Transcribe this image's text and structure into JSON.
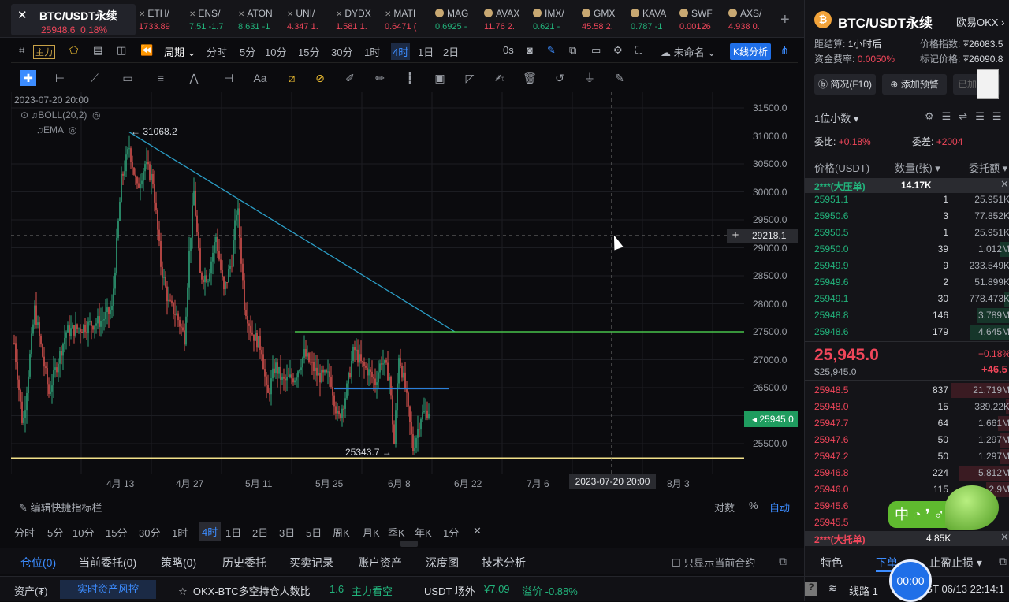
{
  "main_ticker": {
    "symbol": "BTC/USDT永续",
    "price": "25948.6",
    "change": "0.18%"
  },
  "tickers": [
    {
      "name": "ETH/",
      "price": "1733.89",
      "change": "",
      "icon": "x-icon"
    },
    {
      "name": "ENS/",
      "price": "7.51",
      "change": "-1.7",
      "icon": "x-icon"
    },
    {
      "name": "ATON",
      "price": "8.631",
      "change": "-1",
      "icon": "x-icon"
    },
    {
      "name": "UNI/",
      "price": "4.347",
      "change": "1.",
      "icon": "x-icon"
    },
    {
      "name": "DYDX",
      "price": "1.581",
      "change": "1.",
      "icon": "x-icon"
    },
    {
      "name": "MATI",
      "price": "0.6471",
      "change": "(",
      "icon": "x-icon"
    },
    {
      "name": "MAG",
      "price": "0.6925",
      "change": "-",
      "icon": "coin-icon"
    },
    {
      "name": "AVAX",
      "price": "11.76",
      "change": "2.",
      "icon": "coin-icon"
    },
    {
      "name": "IMX/",
      "price": "0.621",
      "change": "-",
      "icon": "coin-icon"
    },
    {
      "name": "GMX",
      "price": "45.58",
      "change": "2.",
      "icon": "coin-icon"
    },
    {
      "name": "KAVA",
      "price": "0.787",
      "change": "-1",
      "icon": "coin-icon"
    },
    {
      "name": "SWF",
      "price": "0.00126",
      "change": "",
      "icon": "coin-icon"
    },
    {
      "name": "AXS/",
      "price": "4.938",
      "change": "0.",
      "icon": "coin-icon"
    }
  ],
  "toolbar": {
    "main_force": "主力",
    "period": "周期",
    "intervals": [
      "分时",
      "5分",
      "10分",
      "15分",
      "30分",
      "1时",
      "4时",
      "1日",
      "2日"
    ],
    "active_interval": "4时",
    "countdown": "0s",
    "unnamed": "未命名",
    "kline_analysis": "K线分析"
  },
  "chart": {
    "datetime": "2023-07-20 20:00",
    "indicator1": "BOLL(20,2)",
    "indicator2": "EMA",
    "high_label": "← 31068.2",
    "low_label": "25343.7 →",
    "crosshair_price": "29218.1",
    "current_price": "25945.0",
    "crosshair_date": "2023-07-20 20:00",
    "y_ticks": [
      "31500.0",
      "31000.0",
      "30500.0",
      "30000.0",
      "29500.0",
      "29000.0",
      "28500.0",
      "28000.0",
      "27500.0",
      "27000.0",
      "26500.0",
      "26000.0",
      "25500.0"
    ],
    "x_ticks": [
      "4月 13",
      "4月 27",
      "5月 11",
      "5月 25",
      "6月 8",
      "6月 22",
      "7月 6",
      "8月 3"
    ]
  },
  "bottom": {
    "edit_bar": "编辑快捷指标栏",
    "log": "对数",
    "pct": "%",
    "auto": "自动",
    "timeframes": [
      "分时",
      "5分",
      "10分",
      "15分",
      "30分",
      "1时",
      "4时",
      "1日",
      "2日",
      "3日",
      "5日",
      "周K",
      "月K",
      "季K",
      "年K",
      "1分"
    ],
    "active_tf": "4时"
  },
  "tabs": [
    "仓位(0)",
    "当前委托(0)",
    "策略(0)",
    "历史委托",
    "买卖记录",
    "账户资产",
    "深度图",
    "技术分析"
  ],
  "only_current": "只显示当前合约",
  "status": {
    "asset": "资产(₮)",
    "risk": "实时资产风控",
    "ratio_label": "OKX-BTC多空持仓人数比",
    "ratio_value": "1.6",
    "ratio_view": "主力看空",
    "usdt_label": "USDT 场外",
    "usdt_price": "¥7.09",
    "usdt_premium": "溢价 -0.88%"
  },
  "right": {
    "title": "BTC/USDT永续",
    "exchange": "欧易OKX",
    "settle_label": "距结算:",
    "settle_value": "1小时后",
    "index_label": "价格指数:",
    "index_value": "₮26083.5",
    "funding_label": "资金费率:",
    "funding_value": "0.0050%",
    "mark_label": "标记价格:",
    "mark_value": "₮26090.8",
    "btn_brief": "简况(F10)",
    "btn_alert": "添加预警",
    "btn_added": "已加",
    "decimals": "1位小数",
    "wb_label": "委比:",
    "wb_value": "+0.18%",
    "wc_label": "委差:",
    "wc_value": "+2004",
    "col_price": "价格(USDT)",
    "col_qty": "数量(张)",
    "col_amt": "委托额",
    "ask_big": "2***(大压单)",
    "ask_big_qty": "14.17K",
    "asks": [
      {
        "p": "25951.1",
        "q": "1",
        "t": "25.951K",
        "w": 0.0
      },
      {
        "p": "25950.6",
        "q": "3",
        "t": "77.852K",
        "w": 0.0
      },
      {
        "p": "25950.5",
        "q": "1",
        "t": "25.951K",
        "w": 0.0
      },
      {
        "p": "25950.0",
        "q": "39",
        "t": "1.012M",
        "w": 0.05
      },
      {
        "p": "25949.9",
        "q": "9",
        "t": "233.549K",
        "w": 0.0
      },
      {
        "p": "25949.6",
        "q": "2",
        "t": "51.899K",
        "w": 0.0
      },
      {
        "p": "25949.1",
        "q": "30",
        "t": "778.473K",
        "w": 0.03
      },
      {
        "p": "25948.8",
        "q": "146",
        "t": "3.789M",
        "w": 0.17
      },
      {
        "p": "25948.6",
        "q": "179",
        "t": "4.645M",
        "w": 0.2
      }
    ],
    "last_price": "25,945.0",
    "last_price_usd": "$25,945.0",
    "last_change": "+0.18%",
    "last_change_abs": "+46.5",
    "bids": [
      {
        "p": "25948.5",
        "q": "837",
        "t": "21.719M",
        "w": 0.3
      },
      {
        "p": "25948.0",
        "q": "15",
        "t": "389.22K",
        "w": 0.02
      },
      {
        "p": "25947.7",
        "q": "64",
        "t": "1.661M",
        "w": 0.06
      },
      {
        "p": "25947.6",
        "q": "50",
        "t": "1.297M",
        "w": 0.05
      },
      {
        "p": "25947.2",
        "q": "50",
        "t": "1.297M",
        "w": 0.05
      },
      {
        "p": "25946.8",
        "q": "224",
        "t": "5.812M",
        "w": 0.26
      },
      {
        "p": "25946.0",
        "q": "115",
        "t": "2.9M",
        "w": 0.12
      },
      {
        "p": "25945.6",
        "q": "",
        "t": "",
        "w": 0.0
      },
      {
        "p": "25945.5",
        "q": "",
        "t": "",
        "w": 0.0
      }
    ],
    "bid_big": "2***(大托单)",
    "bid_big_qty": "4.85K",
    "tab_special": "特色",
    "tab_order": "下单",
    "tab_tpsl": "止盈止损",
    "line_label": "线路 1",
    "time": "06/13 22:14:1",
    "timer": "00:00",
    "zhong": "中"
  }
}
